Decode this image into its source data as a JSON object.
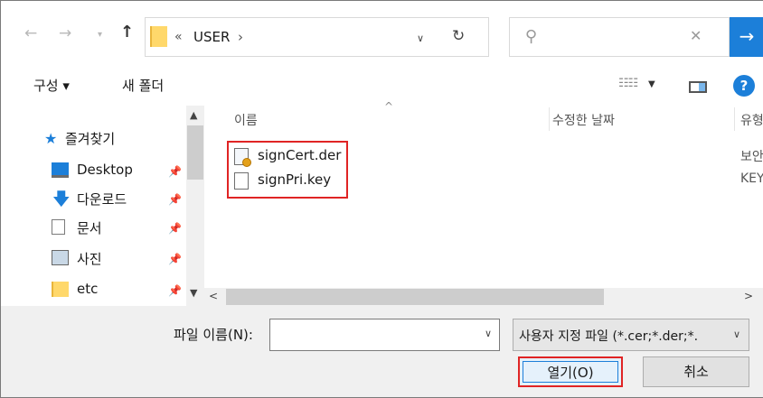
{
  "address_bar": {
    "back_icon": "arrow-left-icon",
    "forward_icon": "arrow-right-icon",
    "up_icon": "arrow-up-icon",
    "path_overflow": "«",
    "current_folder": "USER",
    "path_separator": "›",
    "refresh_icon": "refresh-icon",
    "search_value": ""
  },
  "toolbar": {
    "organize_label": "구성 ▾",
    "new_folder_label": "새 폴더",
    "help_label": "?"
  },
  "nav_pane": {
    "favorites_label": "즐겨찾기",
    "items": [
      {
        "label": "Desktop",
        "icon": "desktop-icon"
      },
      {
        "label": "다운로드",
        "icon": "download-icon"
      },
      {
        "label": "문서",
        "icon": "document-icon"
      },
      {
        "label": "사진",
        "icon": "pictures-icon"
      },
      {
        "label": "etc",
        "icon": "folder-icon"
      }
    ]
  },
  "file_list": {
    "columns": [
      "이름",
      "수정한 날짜",
      "유형"
    ],
    "files": [
      {
        "name": "signCert.der",
        "type": "보안",
        "icon": "certificate-icon"
      },
      {
        "name": "signPri.key",
        "type": "KEY",
        "icon": "file-icon"
      }
    ]
  },
  "bottom": {
    "filename_label": "파일 이름(N):",
    "filename_value": "",
    "filetype_value": "사용자 지정 파일 (*.cer;*.der;*.",
    "open_label": "열기(O)",
    "cancel_label": "취소"
  },
  "colors": {
    "accent": "#1c7fd9",
    "highlight": "#e02424",
    "folder": "#ffd86b"
  }
}
